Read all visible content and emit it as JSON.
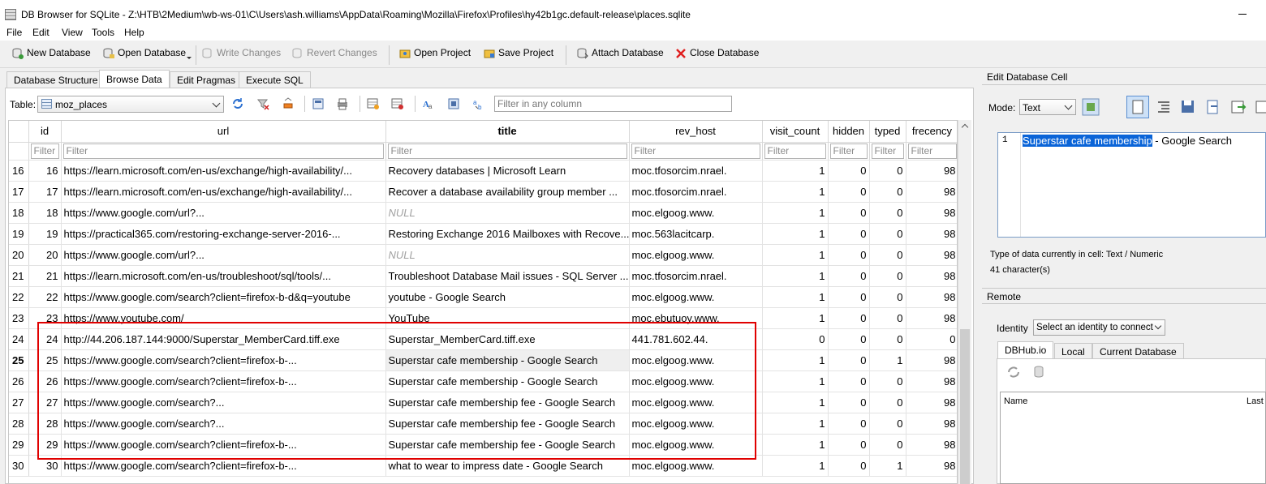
{
  "window": {
    "title": "DB Browser for SQLite - Z:\\HTB\\2Medium\\wb-ws-01\\C\\Users\\ash.williams\\AppData\\Roaming\\Mozilla\\Firefox\\Profiles\\hy42b1gc.default-release\\places.sqlite"
  },
  "menu": [
    "File",
    "Edit",
    "View",
    "Tools",
    "Help"
  ],
  "toolbar": {
    "new_db": "New Database",
    "open_db": "Open Database",
    "write_changes": "Write Changes",
    "revert_changes": "Revert Changes",
    "open_project": "Open Project",
    "save_project": "Save Project",
    "attach_db": "Attach Database",
    "close_db": "Close Database"
  },
  "tabs": [
    "Database Structure",
    "Browse Data",
    "Edit Pragmas",
    "Execute SQL"
  ],
  "active_tab": "Browse Data",
  "browse": {
    "table_label": "Table:",
    "table_value": "moz_places",
    "filter_placeholder": "Filter in any column"
  },
  "grid": {
    "columns": [
      "id",
      "url",
      "title",
      "rev_host",
      "visit_count",
      "hidden",
      "typed",
      "frecency"
    ],
    "filter_text": "Filter",
    "rows": [
      {
        "rownum": "16",
        "id": "16",
        "url": "https://learn.microsoft.com/en-us/exchange/high-availability/...",
        "title": "Recovery databases | Microsoft Learn",
        "rev_host": "moc.tfosorcim.nrael.",
        "visit_count": "1",
        "hidden": "0",
        "typed": "0",
        "frecency": "98"
      },
      {
        "rownum": "17",
        "id": "17",
        "url": "https://learn.microsoft.com/en-us/exchange/high-availability/...",
        "title": "Recover a database availability group member ...",
        "rev_host": "moc.tfosorcim.nrael.",
        "visit_count": "1",
        "hidden": "0",
        "typed": "0",
        "frecency": "98"
      },
      {
        "rownum": "18",
        "id": "18",
        "url": "https://www.google.com/url?...",
        "title": "NULL",
        "rev_host": "moc.elgoog.www.",
        "visit_count": "1",
        "hidden": "0",
        "typed": "0",
        "frecency": "98"
      },
      {
        "rownum": "19",
        "id": "19",
        "url": "https://practical365.com/restoring-exchange-server-2016-...",
        "title": "Restoring Exchange 2016 Mailboxes with Recove...",
        "rev_host": "moc.563lacitcarp.",
        "visit_count": "1",
        "hidden": "0",
        "typed": "0",
        "frecency": "98"
      },
      {
        "rownum": "20",
        "id": "20",
        "url": "https://www.google.com/url?...",
        "title": "NULL",
        "rev_host": "moc.elgoog.www.",
        "visit_count": "1",
        "hidden": "0",
        "typed": "0",
        "frecency": "98"
      },
      {
        "rownum": "21",
        "id": "21",
        "url": "https://learn.microsoft.com/en-us/troubleshoot/sql/tools/...",
        "title": "Troubleshoot Database Mail issues - SQL Server ...",
        "rev_host": "moc.tfosorcim.nrael.",
        "visit_count": "1",
        "hidden": "0",
        "typed": "0",
        "frecency": "98"
      },
      {
        "rownum": "22",
        "id": "22",
        "url": "https://www.google.com/search?client=firefox-b-d&q=youtube",
        "title": "youtube - Google Search",
        "rev_host": "moc.elgoog.www.",
        "visit_count": "1",
        "hidden": "0",
        "typed": "0",
        "frecency": "98"
      },
      {
        "rownum": "23",
        "id": "23",
        "url": "https://www.youtube.com/",
        "title": "YouTube",
        "rev_host": "moc.ebutuoy.www.",
        "visit_count": "1",
        "hidden": "0",
        "typed": "0",
        "frecency": "98"
      },
      {
        "rownum": "24",
        "id": "24",
        "url": "http://44.206.187.144:9000/Superstar_MemberCard.tiff.exe",
        "title": "Superstar_MemberCard.tiff.exe",
        "rev_host": "441.781.602.44.",
        "visit_count": "0",
        "hidden": "0",
        "typed": "0",
        "frecency": "0"
      },
      {
        "rownum": "25",
        "id": "25",
        "url": "https://www.google.com/search?client=firefox-b-...",
        "title": "Superstar cafe membership - Google Search",
        "rev_host": "moc.elgoog.www.",
        "visit_count": "1",
        "hidden": "0",
        "typed": "1",
        "frecency": "98"
      },
      {
        "rownum": "26",
        "id": "26",
        "url": "https://www.google.com/search?client=firefox-b-...",
        "title": "Superstar cafe membership - Google Search",
        "rev_host": "moc.elgoog.www.",
        "visit_count": "1",
        "hidden": "0",
        "typed": "0",
        "frecency": "98"
      },
      {
        "rownum": "27",
        "id": "27",
        "url": "https://www.google.com/search?...",
        "title": "Superstar cafe membership fee - Google Search",
        "rev_host": "moc.elgoog.www.",
        "visit_count": "1",
        "hidden": "0",
        "typed": "0",
        "frecency": "98"
      },
      {
        "rownum": "28",
        "id": "28",
        "url": "https://www.google.com/search?...",
        "title": "Superstar cafe membership fee - Google Search",
        "rev_host": "moc.elgoog.www.",
        "visit_count": "1",
        "hidden": "0",
        "typed": "0",
        "frecency": "98"
      },
      {
        "rownum": "29",
        "id": "29",
        "url": "https://www.google.com/search?client=firefox-b-...",
        "title": "Superstar cafe membership fee - Google Search",
        "rev_host": "moc.elgoog.www.",
        "visit_count": "1",
        "hidden": "0",
        "typed": "0",
        "frecency": "98"
      },
      {
        "rownum": "30",
        "id": "30",
        "url": "https://www.google.com/search?client=firefox-b-...",
        "title": "what to wear to impress date - Google Search",
        "rev_host": "moc.elgoog.www.",
        "visit_count": "1",
        "hidden": "0",
        "typed": "1",
        "frecency": "98"
      }
    ],
    "current_row": "25"
  },
  "edit_cell": {
    "header": "Edit Database Cell",
    "mode_label": "Mode:",
    "mode_value": "Text",
    "line_number": "1",
    "selected_text": "Superstar cafe membership",
    "rest_text": " - Google Search",
    "type_info": "Type of data currently in cell: Text / Numeric",
    "char_info": "41 character(s)"
  },
  "remote": {
    "header": "Remote",
    "identity_label": "Identity",
    "identity_value": "Select an identity to connect",
    "tabs": [
      "DBHub.io",
      "Local",
      "Current Database"
    ],
    "list_columns": [
      "Name",
      "Last"
    ]
  },
  "colors": {
    "highlight_border": "#e00000",
    "selection": "#0a64d8"
  }
}
